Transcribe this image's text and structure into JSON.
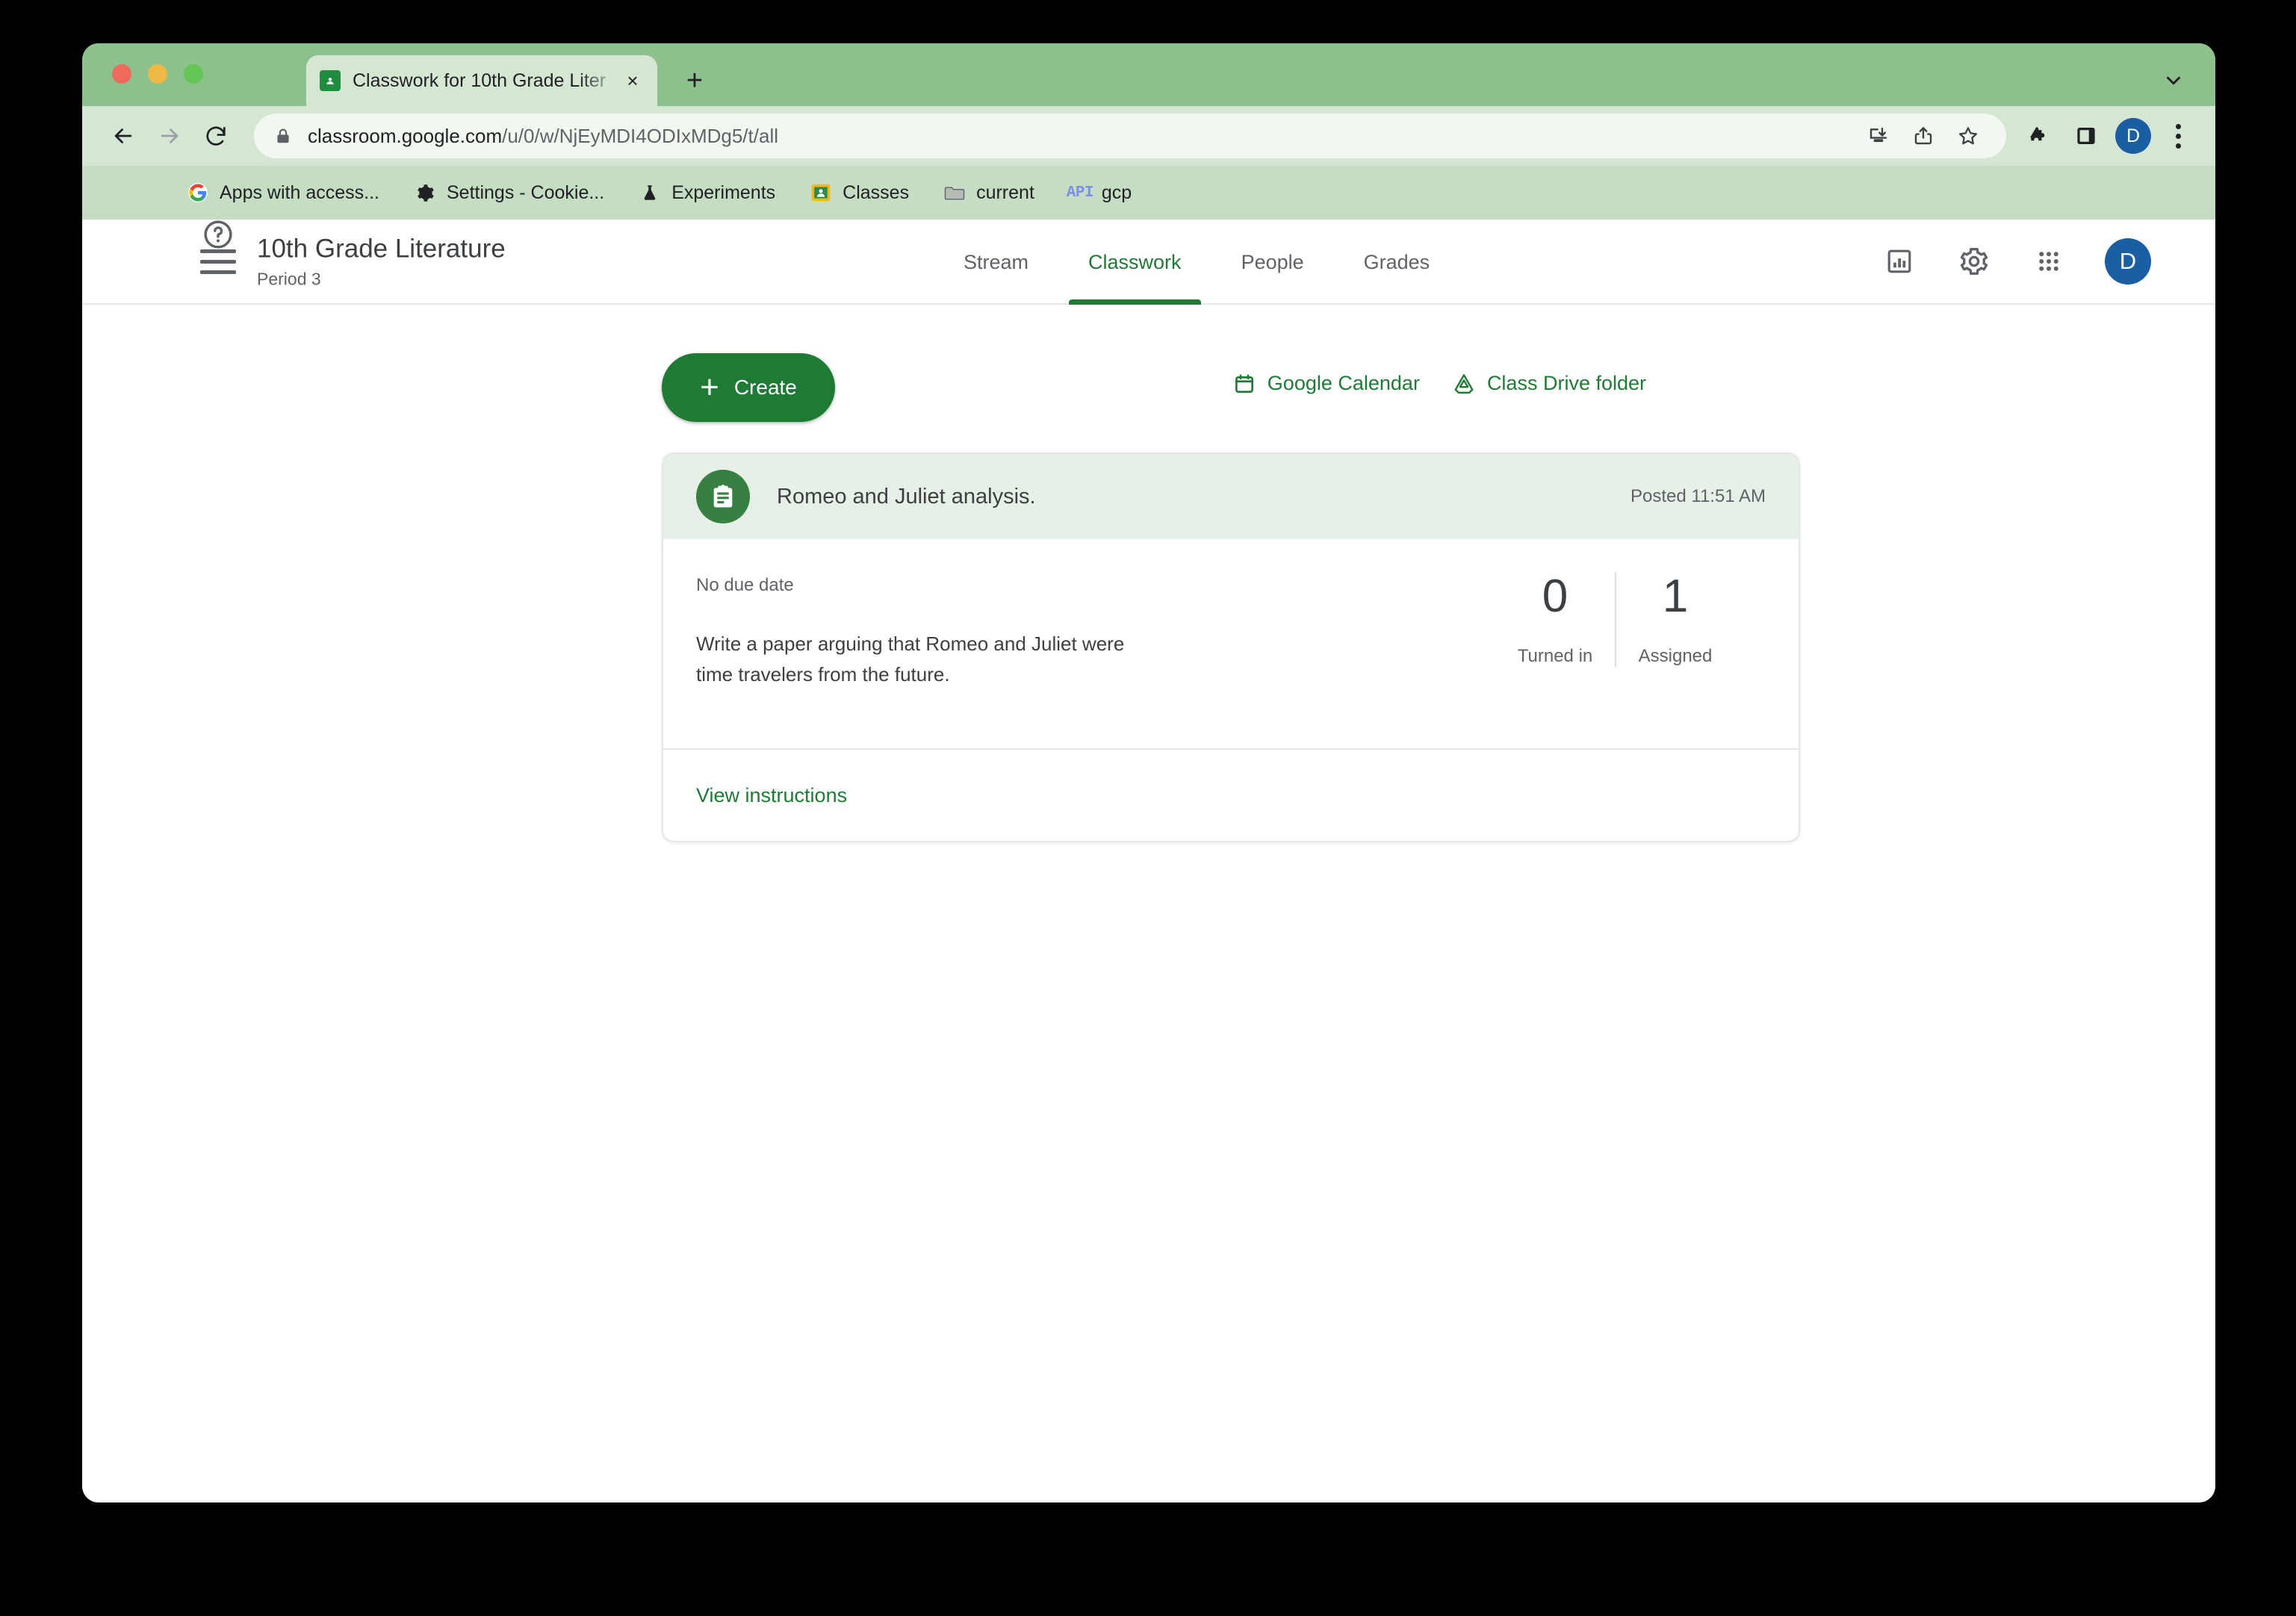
{
  "browser": {
    "tab": {
      "title": "Classwork for 10th Grade Liter",
      "favicon": "classroom-icon",
      "close": "×",
      "new_tab": "+"
    },
    "omnibox": {
      "host": "classroom.google.com",
      "path": "/u/0/w/NjEyMDI4ODIxMDg5/t/all",
      "full_url": "classroom.google.com/u/0/w/NjEyMDI4ODIxMDg5/t/all"
    },
    "profile_initial": "D",
    "bookmarks": [
      {
        "label": "Apps with access...",
        "icon": "google-g-icon"
      },
      {
        "label": "Settings - Cookie...",
        "icon": "gear-icon"
      },
      {
        "label": "Experiments",
        "icon": "flask-icon"
      },
      {
        "label": "Classes",
        "icon": "classroom-icon"
      },
      {
        "label": "current",
        "icon": "folder-icon"
      },
      {
        "label": "gcp",
        "icon": "api-icon"
      }
    ]
  },
  "app": {
    "class_title": "10th Grade Literature",
    "class_section": "Period 3",
    "tabs": [
      {
        "label": "Stream",
        "active": false
      },
      {
        "label": "Classwork",
        "active": true
      },
      {
        "label": "People",
        "active": false
      },
      {
        "label": "Grades",
        "active": false
      }
    ],
    "avatar_initial": "D"
  },
  "classwork": {
    "create_button": "Create",
    "create_plus": "+",
    "quick_links": [
      {
        "label": "Google Calendar",
        "icon": "calendar-icon"
      },
      {
        "label": "Class Drive folder",
        "icon": "drive-icon"
      }
    ],
    "assignment": {
      "title": "Romeo and Juliet analysis.",
      "posted": "Posted 11:51 AM",
      "due_date": "No due date",
      "description": "Write a paper arguing that Romeo and Juliet were time travelers from the future.",
      "stats": [
        {
          "value": "0",
          "label": "Turned in"
        },
        {
          "value": "1",
          "label": "Assigned"
        }
      ],
      "footer_link": "View instructions"
    }
  },
  "colors": {
    "brand_green": "#1e7b34",
    "chrome_green": "#8cc08c",
    "toolbar_green": "#d5e7d3",
    "bookmarks_green": "#c5ddc2",
    "card_head": "#e6f0e6",
    "profile_blue": "#1a5ea3"
  }
}
